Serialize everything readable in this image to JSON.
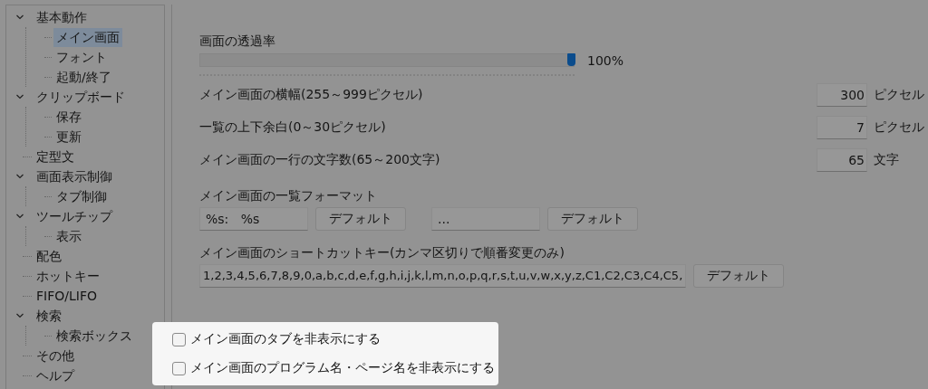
{
  "tree": [
    {
      "label": "基本動作",
      "expanded": true,
      "selected": false,
      "children": [
        {
          "label": "メイン画面",
          "selected": true
        },
        {
          "label": "フォント",
          "selected": false
        },
        {
          "label": "起動/終了",
          "selected": false
        }
      ]
    },
    {
      "label": "クリップボード",
      "expanded": true,
      "selected": false,
      "children": [
        {
          "label": "保存",
          "selected": false
        },
        {
          "label": "更新",
          "selected": false
        }
      ]
    },
    {
      "label": "定型文",
      "selected": false
    },
    {
      "label": "画面表示制御",
      "expanded": true,
      "selected": false,
      "children": [
        {
          "label": "タブ制御",
          "selected": false
        }
      ]
    },
    {
      "label": "ツールチップ",
      "expanded": true,
      "selected": false,
      "children": [
        {
          "label": "表示",
          "selected": false
        }
      ]
    },
    {
      "label": "配色",
      "selected": false
    },
    {
      "label": "ホットキー",
      "selected": false
    },
    {
      "label": "FIFO/LIFO",
      "selected": false
    },
    {
      "label": "検索",
      "expanded": true,
      "selected": false,
      "children": [
        {
          "label": "検索ボックス",
          "selected": false
        }
      ]
    },
    {
      "label": "その他",
      "selected": false
    },
    {
      "label": "ヘルプ",
      "selected": false
    }
  ],
  "opacity": {
    "label": "画面の透過率",
    "level": 1.0,
    "reading": "100%"
  },
  "number_settings": [
    {
      "label": "メイン画面の横幅(255～999ピクセル)",
      "value": "300",
      "unit": "ピクセル"
    },
    {
      "label": "一覧の上下余白(0～30ピクセル)",
      "value": "7",
      "unit": "ピクセル"
    },
    {
      "label": "メイン画面の一行の文字数(65～200文字)",
      "value": "65",
      "unit": "文字"
    }
  ],
  "list_format": {
    "label": "メイン画面の一覧フォーマット",
    "fields": [
      {
        "value": "%s:   %s",
        "button": "デフォルト"
      },
      {
        "value": "...",
        "button": "デフォルト"
      }
    ]
  },
  "shortcut_keys": {
    "label": "メイン画面のショートカットキー(カンマ区切りで順番変更のみ)",
    "value": "1,2,3,4,5,6,7,8,9,0,a,b,c,d,e,f,g,h,i,j,k,l,m,n,o,p,q,r,s,t,u,v,w,x,y,z,C1,C2,C3,C4,C5,",
    "button": "デフォルト"
  },
  "checkboxes": [
    {
      "label": "メイン画面のタブを非表示にする",
      "checked": false
    },
    {
      "label": "メイン画面のプログラム名・ページ名を非表示にする",
      "checked": false
    }
  ]
}
